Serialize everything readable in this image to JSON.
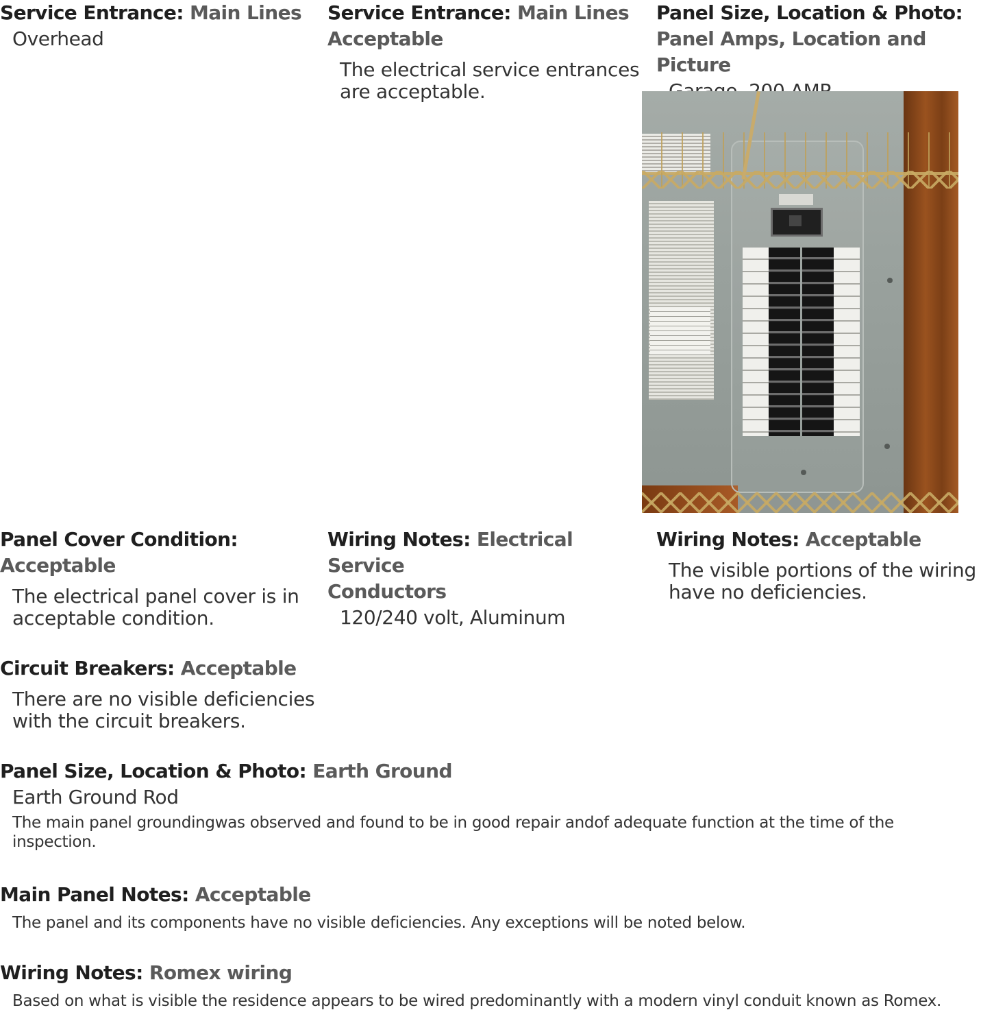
{
  "sections": {
    "service_entrance_overhead": {
      "label": "Service Entrance:",
      "value": "Main Lines",
      "answer": "Overhead"
    },
    "service_entrance_acceptable": {
      "label": "Service Entrance:",
      "value": "Main Lines",
      "status": "Acceptable",
      "comment_line1": "The electrical service entrances",
      "comment_line2": "are acceptable."
    },
    "panel_photo": {
      "label": "Panel Size, Location & Photo:",
      "value": "Panel Amps, Location and Picture",
      "answer": "Garage, 200 AMP"
    },
    "panel_cover": {
      "label": "Panel Cover Condition:",
      "status": "Acceptable",
      "comment_line1": "The electrical panel cover is in",
      "comment_line2": "acceptable condition."
    },
    "wiring_conductors": {
      "label": "Wiring Notes:",
      "value_line1": "Electrical Service",
      "value_line2": "Conductors",
      "answer": "120/240 volt, Aluminum"
    },
    "wiring_acceptable": {
      "label": "Wiring Notes:",
      "status": "Acceptable",
      "comment_line1": "The visible portions of the wiring",
      "comment_line2": "have no deficiencies."
    },
    "circuit_breakers": {
      "label": "Circuit Breakers:",
      "status": "Acceptable",
      "comment_line1": "There are no visible deficiencies",
      "comment_line2": "with the circuit breakers."
    },
    "earth_ground": {
      "label": "Panel Size, Location & Photo:",
      "value": "Earth Ground",
      "answer": "Earth Ground Rod",
      "comment": "The main panel groundingwas observed and found to be in good repair andof adequate function at the time of the inspection."
    },
    "main_panel_notes": {
      "label": "Main Panel Notes:",
      "status": "Acceptable",
      "comment": "The panel and its components have no visible deficiencies. Any exceptions will be noted below."
    },
    "romex_wiring": {
      "label": "Wiring Notes:",
      "value": "Romex wiring",
      "comment": "Based on what is visible the residence appears to be wired predominantly with a modern vinyl conduit known as Romex."
    }
  }
}
